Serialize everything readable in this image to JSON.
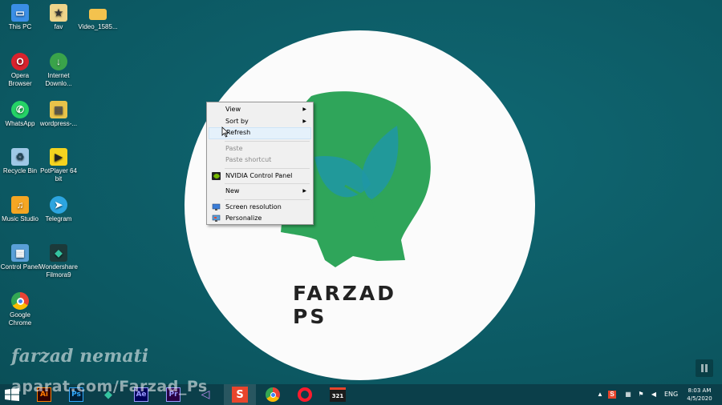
{
  "desktop": {
    "icons": [
      {
        "label": "This PC",
        "icon": "computer-icon",
        "color": "#3a8ee6"
      },
      {
        "label": "fav",
        "icon": "bookmark-file-icon",
        "color": "#eed48a"
      },
      {
        "label": "Video_1585...",
        "icon": "folder-icon",
        "color": "#f3c24e"
      },
      {
        "label": "Opera Browser",
        "icon": "opera-icon",
        "color": "#d9232d"
      },
      {
        "label": "Internet Downlo...",
        "icon": "download-manager-icon",
        "color": "#3aa34a"
      },
      {
        "label": "WhatsApp",
        "icon": "whatsapp-icon",
        "color": "#25d366"
      },
      {
        "label": "wordpress-...",
        "icon": "zip-folder-icon",
        "color": "#e8c34a"
      },
      {
        "label": "Recycle Bin",
        "icon": "recycle-bin-icon",
        "color": "#9fc8e6"
      },
      {
        "label": "PotPlayer 64 bit",
        "icon": "potplayer-icon",
        "color": "#f4d31f"
      },
      {
        "label": "Music Studio",
        "icon": "music-studio-icon",
        "color": "#f5a623"
      },
      {
        "label": "Telegram",
        "icon": "telegram-icon",
        "color": "#2ca5e0"
      },
      {
        "label": "Control Panel",
        "icon": "control-panel-icon",
        "color": "#5aa0d8"
      },
      {
        "label": "Wondershare Filmora9",
        "icon": "filmora-icon",
        "color": "#35c4a0"
      },
      {
        "label": "Google Chrome",
        "icon": "chrome-icon",
        "color": "#4285f4"
      }
    ]
  },
  "wallpaper": {
    "logo_text": "FARZAD PS",
    "head_color": "#2fa55a",
    "leaf_color": "#1f97a6",
    "circle_color": "#fbfbfb"
  },
  "watermark": {
    "name": "farzad nemati",
    "url": "aparat.com/Farzad_Ps"
  },
  "context_menu": {
    "items": {
      "view": "View",
      "sort_by": "Sort by",
      "refresh": "Refresh",
      "paste": "Paste",
      "paste_shortcut": "Paste shortcut",
      "nvidia": "NVIDIA Control Panel",
      "new": "New",
      "screen_resolution": "Screen resolution",
      "personalize": "Personalize"
    },
    "submenu_arrow": "▶"
  },
  "taskbar": {
    "apps": [
      {
        "name": "Adobe Illustrator",
        "short": "Ai",
        "color": "#ff7c00",
        "bg": "#330000"
      },
      {
        "name": "Adobe Photoshop",
        "short": "Ps",
        "color": "#31a8ff",
        "bg": "#001e36"
      },
      {
        "name": "Filmora",
        "short": "◆",
        "color": "#35c4a0",
        "bg": "#0b3f4a"
      },
      {
        "name": "Adobe After Effects",
        "short": "Ae",
        "color": "#9999ff",
        "bg": "#00005b"
      },
      {
        "name": "Adobe Premiere",
        "short": "Pr",
        "color": "#9999ff",
        "bg": "#2a0045"
      },
      {
        "name": "Visual Studio",
        "short": "◁",
        "color": "#c28ef3",
        "bg": "#0b3f4a"
      },
      {
        "name": "Snagit",
        "short": "S",
        "color": "#ffffff",
        "bg": "#e8452c"
      },
      {
        "name": "Google Chrome",
        "short": "",
        "color": "#4285f4",
        "bg": "#0b3f4a"
      },
      {
        "name": "Opera",
        "short": "O",
        "color": "#ff1b2d",
        "bg": "#0b3f4a"
      },
      {
        "name": "Calendar",
        "short": "321",
        "color": "#ffffff",
        "bg": "#1c1c1c"
      }
    ],
    "language": "ENG",
    "time": "8:03 AM",
    "date": "4/5/2020"
  }
}
